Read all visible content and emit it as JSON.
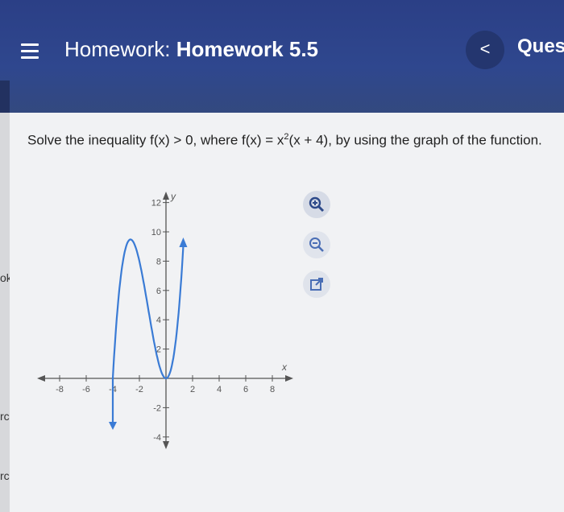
{
  "header": {
    "prefix": "Homework:",
    "title": "Homework 5.5",
    "back_label": "<",
    "right_label": "Ques"
  },
  "sidebar": {
    "items": [
      "ok",
      "rce",
      "rce"
    ]
  },
  "question": {
    "text_before": "Solve the inequality f(x) > 0, where f(x) = x",
    "exponent": "2",
    "text_after": "(x + 4), by using the graph of the function."
  },
  "graph": {
    "x_label": "x",
    "y_label": "y",
    "x_ticks": [
      "-8",
      "-6",
      "-4",
      "-2",
      "2",
      "4",
      "6",
      "8"
    ],
    "y_ticks": [
      "12",
      "10",
      "8",
      "6",
      "4",
      "2",
      "-2",
      "-4"
    ]
  },
  "tools": [
    {
      "name": "zoom-in-icon"
    },
    {
      "name": "zoom-out-icon"
    },
    {
      "name": "external-link-icon"
    }
  ],
  "colors": {
    "header": "#2f478e",
    "curve": "#3a7bd5",
    "axis": "#555555"
  },
  "chart_data": {
    "type": "line",
    "function": "x^2(x+4)",
    "x": [
      -4,
      -3.5,
      -3,
      -2.67,
      -2,
      -1.5,
      -1,
      -0.5,
      0,
      0.5,
      1,
      1.3
    ],
    "y": [
      0,
      6.1,
      9,
      9.5,
      8,
      5.6,
      3,
      0.9,
      0,
      1.1,
      5,
      9.2
    ],
    "xlim": [
      -9,
      9
    ],
    "ylim": [
      -5,
      13
    ],
    "xlabel": "x",
    "ylabel": "y"
  }
}
